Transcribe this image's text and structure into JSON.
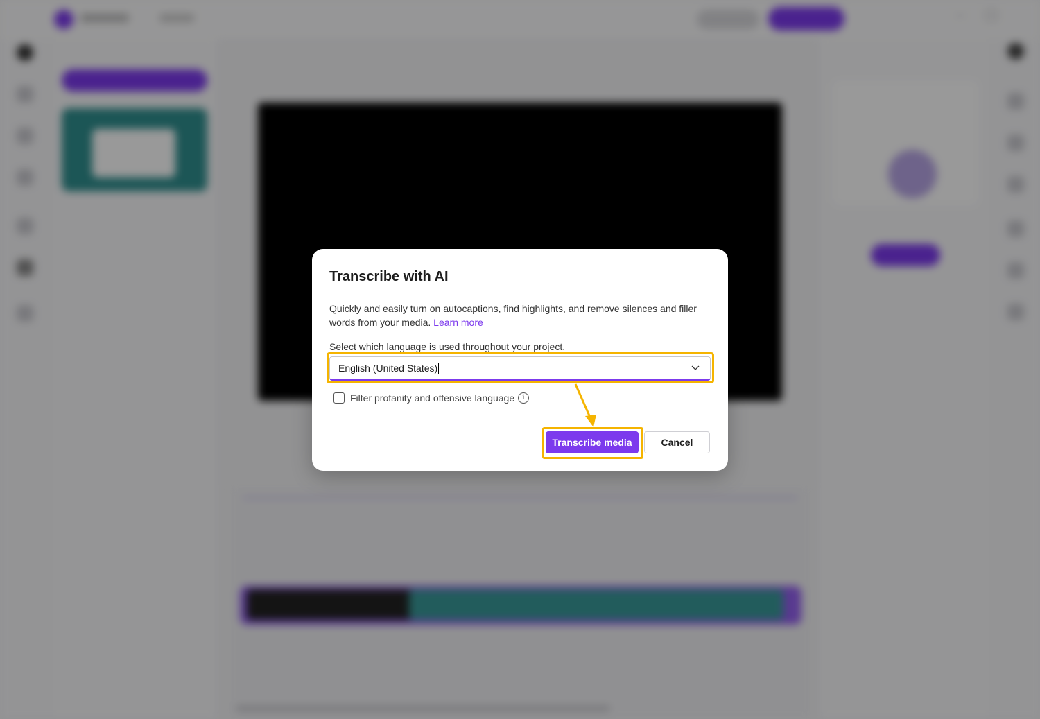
{
  "dialog": {
    "title": "Transcribe with AI",
    "description": "Quickly and easily turn on autocaptions, find highlights, and remove silences and filler words from your media.",
    "learn_more": "Learn more",
    "language_label": "Select which language is used throughout your project.",
    "language_value": "English (United States)",
    "filter_label": "Filter profanity and offensive language",
    "filter_checked": false,
    "primary_button": "Transcribe media",
    "cancel_button": "Cancel"
  },
  "icons": {
    "chevron": "chevron-down-icon",
    "info": "info-icon",
    "checkbox": "checkbox-icon"
  },
  "colors": {
    "accent": "#7c3aed",
    "highlight": "#f5b400",
    "overlay": "rgba(0,0,0,0.40)"
  }
}
